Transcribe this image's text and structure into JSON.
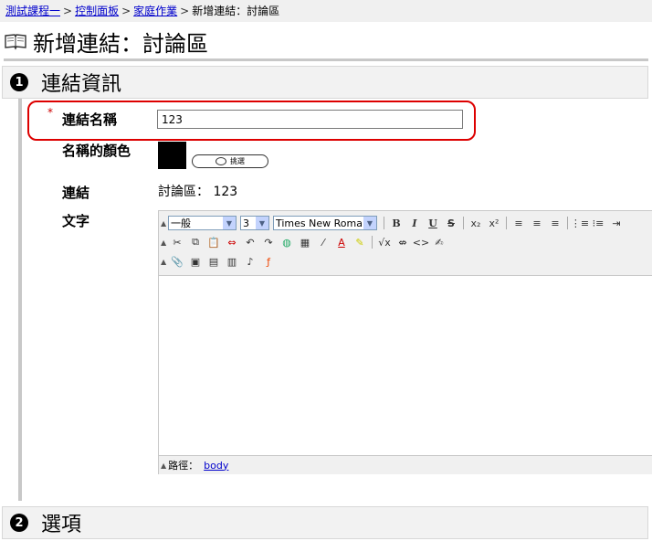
{
  "breadcrumb": {
    "items": [
      "測試課程一",
      "控制面板",
      "家庭作業"
    ],
    "separator": ">",
    "current": "新增連結：討論區"
  },
  "page": {
    "title": "新增連結：討論區",
    "icon": "book-icon"
  },
  "section1": {
    "number": "1",
    "title": "連結資訊"
  },
  "section2": {
    "number": "2",
    "title": "選項"
  },
  "form": {
    "required_mark": "*",
    "name_label": "連結名稱",
    "name_value": "123",
    "color_label": "名稱的顏色",
    "color_value": "#000000",
    "pick_button_label": "挑選",
    "link_label": "連結",
    "link_value": "討論區： 123",
    "text_label": "文字"
  },
  "editor": {
    "format_select": "一般",
    "size_select": "3",
    "font_select": "Times New Roman",
    "status_label": "路徑：",
    "status_path": "body"
  },
  "colors": {
    "highlight": "#dd0000",
    "accent_link": "#0000cc"
  }
}
